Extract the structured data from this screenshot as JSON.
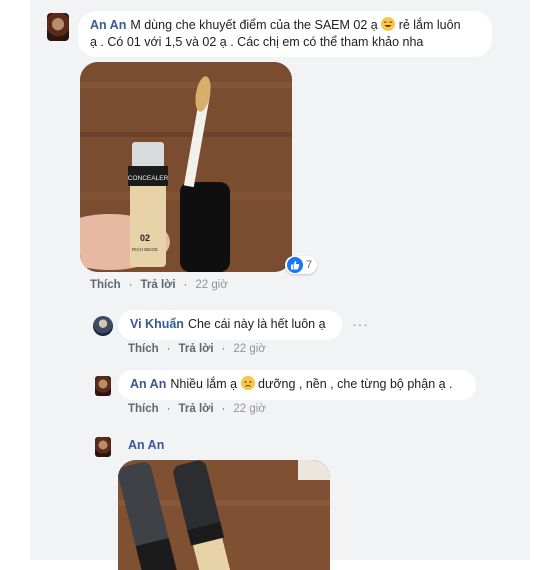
{
  "comments": [
    {
      "author": "An An",
      "text_before_emoji": "M dùng che khuyết điểm của the SAEM 02 ạ",
      "text_after_emoji": "rẻ lắm luôn",
      "text_line2": "ạ . Có 01 với 1,5 và 02 ạ . Các chị em có thể tham khảo nha",
      "photo": {
        "product_label_brand": "CONCEALER",
        "product_label_shade": "02",
        "product_label_line": "RICH BEIGE"
      },
      "reactions": {
        "count": "7",
        "icon": "like-icon"
      },
      "actions": {
        "like": "Thích",
        "reply": "Trả lời",
        "time": "22 giờ"
      }
    }
  ],
  "replies": [
    {
      "author": "Vi Khuẩn",
      "text": "Che cái này là hết luôn ạ",
      "more": "···",
      "actions": {
        "like": "Thích",
        "reply": "Trả lời",
        "time": "22 giờ"
      }
    },
    {
      "author": "An An",
      "text_before_emoji": "Nhiều lắm ạ",
      "text_after_emoji": "dưỡng , nền , che từng bộ phận ạ .",
      "actions": {
        "like": "Thích",
        "reply": "Trả lời",
        "time": "22 giờ"
      }
    },
    {
      "author": "An An"
    }
  ],
  "colors": {
    "feed_bg": "#f2f3f5",
    "author": "#385898",
    "like_blue": "#1877f2"
  }
}
